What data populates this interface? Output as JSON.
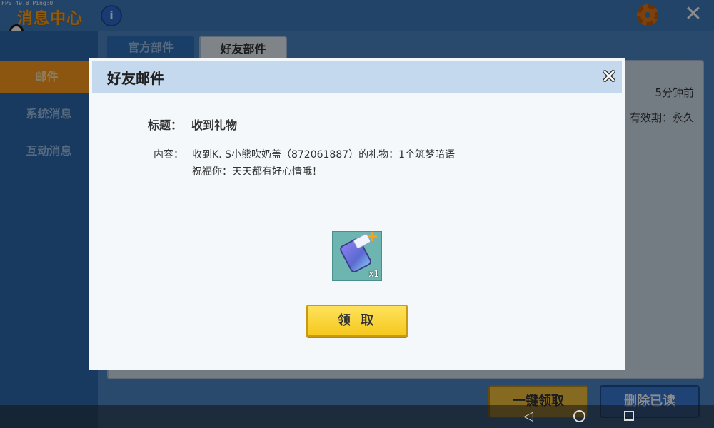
{
  "debug": {
    "text": "FPS 49.8  Ping:0"
  },
  "header": {
    "title": "消息中心",
    "info_icon": "i",
    "settings_icon": "gear-icon",
    "close_icon": "✕"
  },
  "sidebar": {
    "items": [
      {
        "label": "邮件",
        "active": true
      },
      {
        "label": "系统消息",
        "active": false
      },
      {
        "label": "互动消息",
        "active": false
      }
    ]
  },
  "tabs": [
    {
      "label": "官方部件",
      "active": false
    },
    {
      "label": "好友部件",
      "active": true
    }
  ],
  "mail_card": {
    "time": "5分钟前",
    "expire": "有效期：永久"
  },
  "footer_buttons": {
    "claim_all": "一键领取",
    "delete_read": "删除已读"
  },
  "dialog": {
    "title": "好友邮件",
    "close_icon": "✕",
    "subject_label": "标题：",
    "subject_value": "收到礼物",
    "content_label": "内容：",
    "content_line1": "收到K. S小熊吹奶盖（872061887）的礼物：1个筑梦暗语",
    "content_line2": "祝福你：天天都有好心情哦！",
    "gift": {
      "icon": "gift-jar-icon",
      "count": "x1"
    },
    "claim_button": "领 取"
  },
  "nav": {
    "back": "◁",
    "home": "home-circle-icon",
    "recent": "recent-square-icon"
  }
}
